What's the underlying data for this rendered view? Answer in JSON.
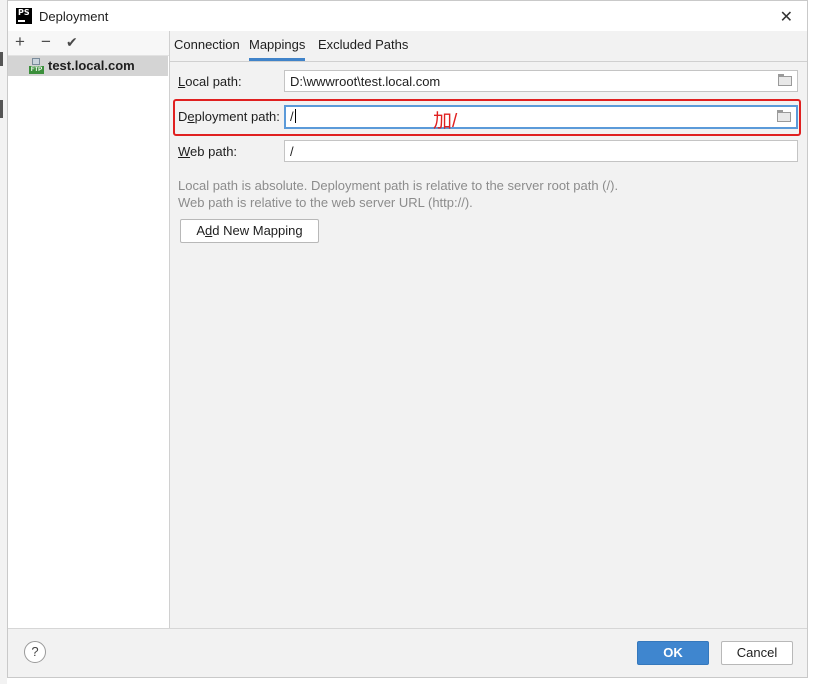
{
  "window": {
    "title": "Deployment"
  },
  "toolbar": {
    "add": "+",
    "remove": "−",
    "apply": "✔"
  },
  "sidebar": {
    "servers": [
      {
        "label": "test.local.com",
        "icon_tag": "FTP"
      }
    ]
  },
  "tabs": [
    {
      "label": "Connection",
      "active": false
    },
    {
      "label": "Mappings",
      "active": true
    },
    {
      "label": "Excluded Paths",
      "active": false
    }
  ],
  "mappings": {
    "local_path": {
      "label_mnemonic": "L",
      "label_rest": "ocal path:",
      "value": "D:\\wwwroot\\test.local.com"
    },
    "deployment_path": {
      "label_pre": "D",
      "label_mnemonic": "e",
      "label_rest": "ployment path:",
      "value": "/"
    },
    "web_path": {
      "label_mnemonic": "W",
      "label_rest": "eb path:",
      "value": "/"
    },
    "hint_line1": "Local path is absolute. Deployment path is relative to the server root path (/).",
    "hint_line2": "Web path is relative to the web server URL (http://).",
    "add_mapping": {
      "pre": "A",
      "mnemonic": "d",
      "rest": "d New Mapping"
    }
  },
  "annotation": {
    "text": "加/",
    "color": "#e02020"
  },
  "footer": {
    "help": "?",
    "ok": "OK",
    "cancel": "Cancel"
  },
  "colors": {
    "accent": "#3f86cf",
    "annotation": "#e02020"
  }
}
